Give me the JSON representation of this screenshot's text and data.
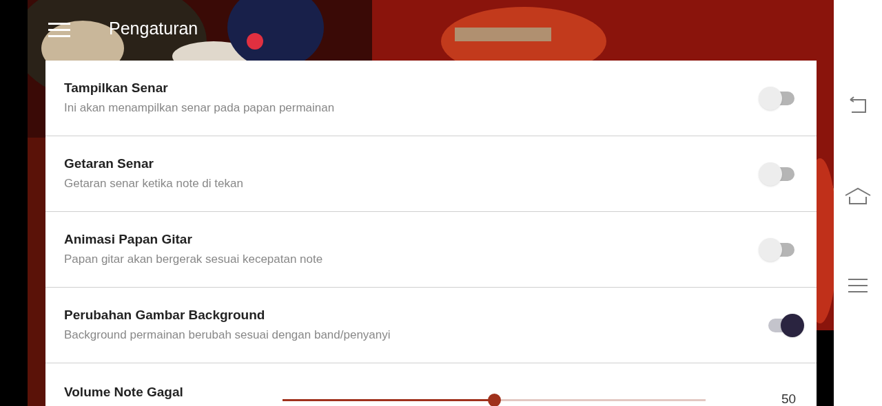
{
  "app_bar": {
    "title": "Pengaturan"
  },
  "settings": [
    {
      "kind": "toggle",
      "title": "Tampilkan Senar",
      "description": "Ini akan menampilkan senar pada papan permainan",
      "on": false
    },
    {
      "kind": "toggle",
      "title": "Getaran Senar",
      "description": "Getaran senar ketika note di tekan",
      "on": false
    },
    {
      "kind": "toggle",
      "title": "Animasi Papan Gitar",
      "description": "Papan gitar akan bergerak sesuai kecepatan note",
      "on": false
    },
    {
      "kind": "toggle",
      "title": "Perubahan Gambar Background",
      "description": "Background permainan berubah sesuai dengan band/penyanyi",
      "on": true
    },
    {
      "kind": "slider",
      "title": "Volume Note Gagal",
      "level": 0.5,
      "reading": "50"
    }
  ]
}
